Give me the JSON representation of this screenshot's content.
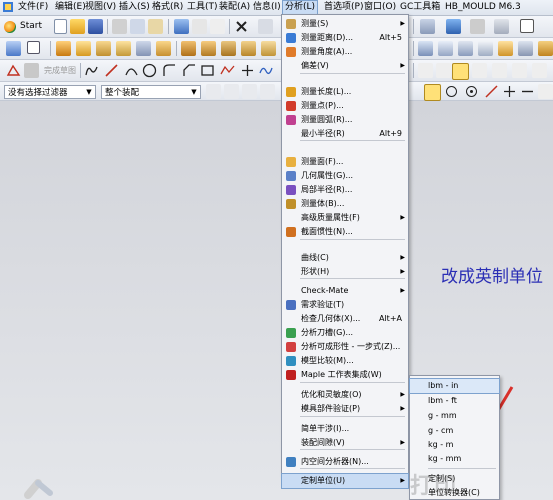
{
  "menubar": {
    "items": [
      "文件(F)",
      "编辑(E)",
      "视图(V)",
      "插入(S)",
      "格式(R)",
      "工具(T)",
      "装配(A)",
      "信息(I)",
      "分析(L)",
      "首选项(P)",
      "窗口(O)",
      "GC工具箱",
      "HB_MOULD M6.3"
    ]
  },
  "toolbar": {
    "start_label": "Start",
    "filter_label": "没有选择过滤器",
    "assembly_label": "整个装配",
    "sketch_label": "完成草图"
  },
  "analysis_menu": {
    "items": [
      {
        "label": "测量(S)",
        "shortcut": "",
        "submenu": true,
        "icon": "measure-icon"
      },
      {
        "label": "测量距离(D)...",
        "shortcut": "Alt+5",
        "submenu": false,
        "icon": "measure-distance-icon"
      },
      {
        "label": "测量角度(A)...",
        "shortcut": "",
        "submenu": false,
        "icon": "measure-angle-icon"
      },
      {
        "label": "偏差(V)",
        "shortcut": "",
        "submenu": true,
        "icon": ""
      },
      {
        "label": "测量长度(L)...",
        "shortcut": "",
        "submenu": false,
        "icon": "measure-length-icon"
      },
      {
        "label": "测量点(P)...",
        "shortcut": "",
        "submenu": false,
        "icon": "measure-point-icon"
      },
      {
        "label": "测量圆弧(R)...",
        "shortcut": "",
        "submenu": false,
        "icon": "measure-arc-icon"
      },
      {
        "label": "最小半径(R)",
        "shortcut": "Alt+9",
        "submenu": false,
        "icon": ""
      },
      {
        "label": "测量面(F)...",
        "shortcut": "",
        "submenu": false,
        "icon": "measure-face-icon"
      },
      {
        "label": "几何属性(G)...",
        "shortcut": "",
        "submenu": false,
        "icon": "geometry-props-icon"
      },
      {
        "label": "局部半径(R)...",
        "shortcut": "",
        "submenu": false,
        "icon": "local-radius-icon"
      },
      {
        "label": "测量体(B)...",
        "shortcut": "",
        "submenu": false,
        "icon": "measure-body-icon"
      },
      {
        "label": "高级质量属性(F)",
        "shortcut": "",
        "submenu": true,
        "icon": ""
      },
      {
        "label": "截面惯性(N)...",
        "shortcut": "",
        "submenu": false,
        "icon": "section-inertia-icon"
      },
      {
        "label": "曲线(C)",
        "shortcut": "",
        "submenu": true,
        "icon": ""
      },
      {
        "label": "形状(H)",
        "shortcut": "",
        "submenu": true,
        "icon": ""
      },
      {
        "label": "Check-Mate",
        "shortcut": "",
        "submenu": true,
        "icon": ""
      },
      {
        "label": "需求验证(T)",
        "shortcut": "",
        "submenu": false,
        "icon": "requirements-icon"
      },
      {
        "label": "检查几何体(X)...",
        "shortcut": "Alt+A",
        "submenu": false,
        "icon": ""
      },
      {
        "label": "分析刀槽(G)...",
        "shortcut": "",
        "submenu": false,
        "icon": "tool-groove-icon"
      },
      {
        "label": "分析可成形性 - 一步式(Z)...",
        "shortcut": "",
        "submenu": false,
        "icon": "formability-icon"
      },
      {
        "label": "模型比较(M)...",
        "shortcut": "",
        "submenu": false,
        "icon": "model-compare-icon"
      },
      {
        "label": "Maple 工作表集成(W)",
        "shortcut": "",
        "submenu": false,
        "icon": "maple-icon"
      },
      {
        "label": "优化和灵敏度(O)",
        "shortcut": "",
        "submenu": true,
        "icon": ""
      },
      {
        "label": "模具部件验证(P)",
        "shortcut": "",
        "submenu": true,
        "icon": ""
      },
      {
        "label": "简单干涉(I)...",
        "shortcut": "",
        "submenu": false,
        "icon": ""
      },
      {
        "label": "装配间隙(V)",
        "shortcut": "",
        "submenu": true,
        "icon": ""
      },
      {
        "label": "内空间分析器(N)...",
        "shortcut": "",
        "submenu": false,
        "icon": "space-analyzer-icon"
      },
      {
        "label": "定制单位(U)",
        "shortcut": "",
        "submenu": true,
        "icon": ""
      }
    ]
  },
  "units_submenu": {
    "items": [
      "lbm - in",
      "lbm - ft",
      "g - mm",
      "g - cm",
      "kg - m",
      "kg - mm",
      "定制(S)",
      "单位转换器(C)"
    ]
  },
  "annotation": {
    "text": "改成英制单位",
    "color": "#2b2fb5",
    "arrow_color": "#d9302a"
  },
  "watermark": {
    "text": "打印"
  },
  "colors": {
    "highlight": "#c9dcf4",
    "menu_bg": "#f3f4f7"
  }
}
